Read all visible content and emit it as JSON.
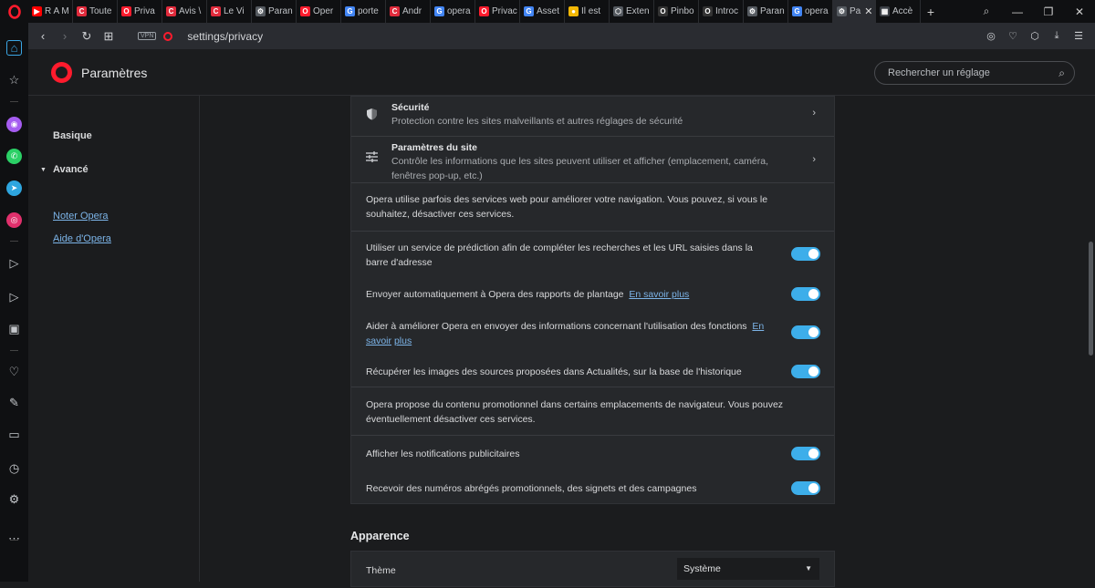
{
  "tabs": [
    {
      "label": "R A M",
      "color": "#ff0000",
      "glyph": "▶"
    },
    {
      "label": "Toute",
      "color": "#e02b3c",
      "glyph": "C"
    },
    {
      "label": "Priva",
      "color": "#ff1b2d",
      "glyph": "O"
    },
    {
      "label": "Avis \\",
      "color": "#e02b3c",
      "glyph": "C"
    },
    {
      "label": "Le Vi",
      "color": "#e02b3c",
      "glyph": "C"
    },
    {
      "label": "Paran",
      "color": "#555a60",
      "glyph": "⚙"
    },
    {
      "label": "Oper",
      "color": "#ff1b2d",
      "glyph": "O"
    },
    {
      "label": "porte",
      "color": "#4285f4",
      "glyph": "G"
    },
    {
      "label": "Andr",
      "color": "#e02b3c",
      "glyph": "C"
    },
    {
      "label": "opera",
      "color": "#4285f4",
      "glyph": "G"
    },
    {
      "label": "Privac",
      "color": "#ff1b2d",
      "glyph": "O"
    },
    {
      "label": "Asset",
      "color": "#4285f4",
      "glyph": "G"
    },
    {
      "label": "Il est",
      "color": "#f2b705",
      "glyph": "●"
    },
    {
      "label": "Exten",
      "color": "#555a60",
      "glyph": "⬡"
    },
    {
      "label": "Pinbo",
      "color": "#333333",
      "glyph": "O"
    },
    {
      "label": "Introc",
      "color": "#333333",
      "glyph": "O"
    },
    {
      "label": "Paran",
      "color": "#555a60",
      "glyph": "⚙"
    },
    {
      "label": "opera",
      "color": "#4285f4",
      "glyph": "G"
    }
  ],
  "active_tab": {
    "label": "Pa",
    "glyph": "⚙",
    "close": "✕"
  },
  "after_tab": {
    "label": "Accè",
    "glyph": "▦"
  },
  "new_tab": "+",
  "window": {
    "search": "⌕",
    "minimize": "—",
    "restore": "❐",
    "close": "✕"
  },
  "address": {
    "back": "‹",
    "forward": "›",
    "reload": "↻",
    "tabs_grid": "⊞",
    "vpn": "VPN",
    "url": "settings/privacy",
    "icons": [
      "◎",
      "♡",
      "⬡",
      "⤓",
      "☰"
    ]
  },
  "sidebar": {
    "icons": [
      "⌂",
      "☆",
      "◉",
      "✆",
      "➤",
      "◎",
      "▷",
      "▷",
      "▣",
      "♡",
      "✎",
      "▭",
      "◷",
      "⚙",
      "⋯"
    ]
  },
  "header": {
    "title": "Paramètres",
    "search_placeholder": "Rechercher un réglage",
    "search_icon": "⌕"
  },
  "leftnav": {
    "basic": "Basique",
    "advanced": "Avancé",
    "advanced_marker": "▼",
    "rate": "Noter Opera",
    "help": "Aide d'Opera"
  },
  "privacy": {
    "security": {
      "title": "Sécurité",
      "desc": "Protection contre les sites malveillants et autres réglages de sécurité"
    },
    "site_settings": {
      "title": "Paramètres du site",
      "desc": "Contrôle les informations que les sites peuvent utiliser et afficher (emplacement, caméra, fenêtres pop-up, etc.)"
    },
    "web_services_info": "Opera utilise parfois des services web pour améliorer votre navigation. Vous pouvez, si vous le souhaitez, désactiver ces services.",
    "prediction": {
      "label": "Utiliser un service de prédiction afin de compléter les recherches et les URL saisies dans la barre d'adresse",
      "on": true
    },
    "crash_reports": {
      "label": "Envoyer automatiquement à Opera des rapports de plantage",
      "link": "En savoir plus",
      "on": true
    },
    "usage_info": {
      "label": "Aider à améliorer Opera en envoyer des informations concernant l'utilisation des fonctions",
      "link_a": "En savoir",
      "link_b": "plus",
      "on": true
    },
    "news_images": {
      "label": "Récupérer les images des sources proposées dans Actualités, sur la base de l'historique",
      "on": true
    },
    "promo_info": "Opera propose du contenu promotionnel dans certains emplacements de navigateur. Vous pouvez éventuellement désactiver ces services.",
    "ad_notifications": {
      "label": "Afficher les notifications publicitaires",
      "on": true
    },
    "promo_speed_dials": {
      "label": "Recevoir des numéros abrégés promotionnels, des signets et des campagnes",
      "on": true
    },
    "chevron": "›"
  },
  "appearance": {
    "title": "Apparence",
    "theme_label": "Thème",
    "theme_value": "Système",
    "caret": "▼"
  },
  "colors": {
    "accent": "#3daeea",
    "brand": "#ff1b2d",
    "link": "#7cb4e8"
  }
}
